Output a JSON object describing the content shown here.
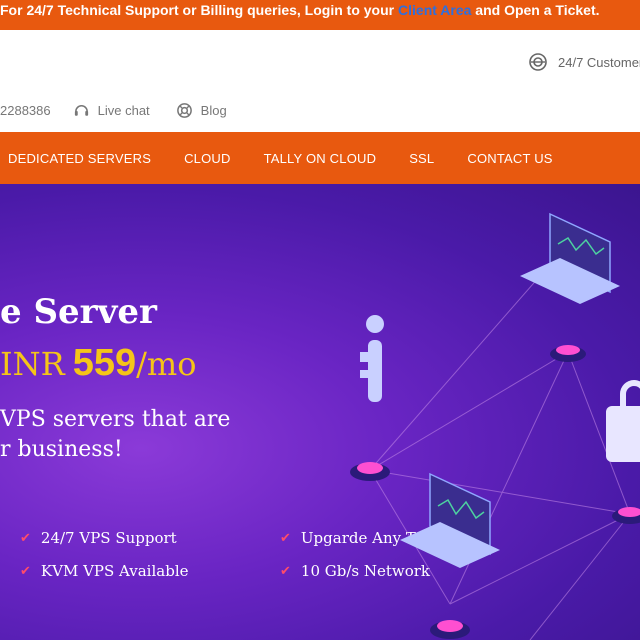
{
  "topbar": {
    "prefix": "For 24/7 Technical Support or Billing queries, Login to your ",
    "link": "Client Area",
    "suffix": " and Open a Ticket."
  },
  "header": {
    "support_text": "24/7 Customer",
    "phone": "2288386",
    "live_chat": "Live chat",
    "blog": "Blog"
  },
  "nav": {
    "items": [
      "DEDICATED SERVERS",
      "CLOUD",
      "TALLY ON CLOUD",
      "SSL",
      "CONTACT US"
    ]
  },
  "hero": {
    "title": "e Server",
    "price_prefix": "INR",
    "price_amount": "559",
    "price_suffix": "/mo",
    "desc_line1": "VPS servers that are",
    "desc_line2": "r business!",
    "features": [
      "24/7 VPS Support",
      "Upgarde Any Time",
      "KVM VPS Available",
      "10 Gb/s Network"
    ]
  },
  "colors": {
    "brand_orange": "#e8590f",
    "hero_purple": "#6a25c4",
    "price_yellow": "#f5c518",
    "link_blue": "#2d6fe0"
  },
  "icons": [
    "support-icon",
    "headset-icon",
    "lifebuoy-icon",
    "check-icon"
  ]
}
